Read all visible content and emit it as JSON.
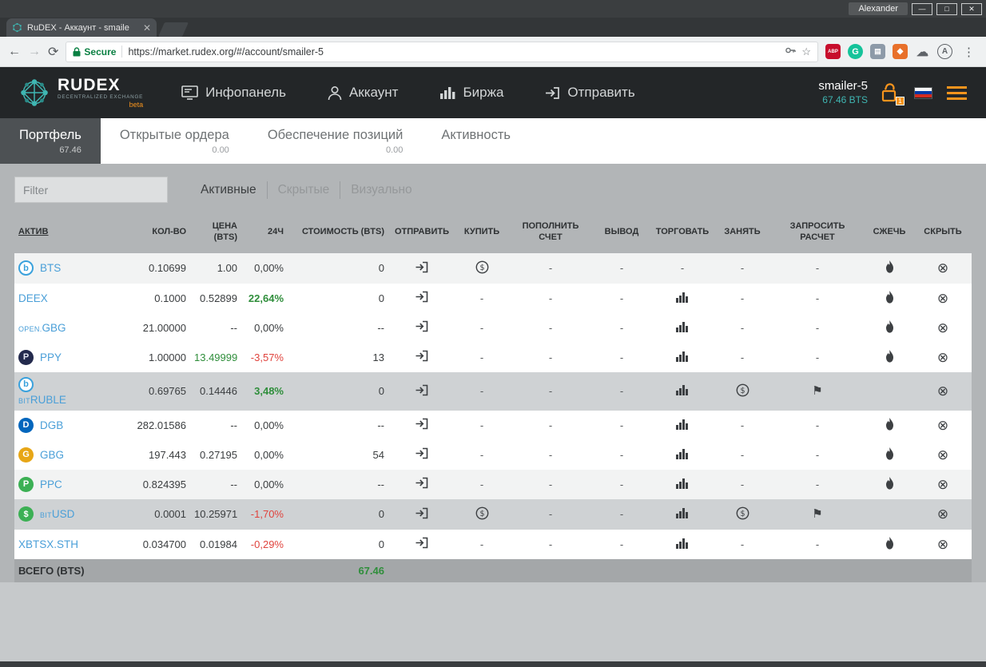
{
  "browser": {
    "user_button": "Alexander",
    "minimize": "—",
    "maximize": "□",
    "close": "✕",
    "tab_title": "RuDEX - Аккаунт - smaile",
    "secure_label": "Secure",
    "url": "https://market.rudex.org/#/account/smailer-5"
  },
  "header": {
    "logo_title": "RUDEX",
    "logo_subtitle": "DECENTRALIZED EXCHANGE",
    "logo_beta": "beta",
    "nav": [
      {
        "label": "Инфопанель"
      },
      {
        "label": "Аккаунт"
      },
      {
        "label": "Биржа"
      },
      {
        "label": "Отправить"
      }
    ],
    "account_name": "smailer-5",
    "account_balance": "67.46 BTS",
    "unlock_badge": "1"
  },
  "page_tabs": [
    {
      "label": "Портфель",
      "value": "67.46"
    },
    {
      "label": "Открытые ордера",
      "value": "0.00"
    },
    {
      "label": "Обеспечение позиций",
      "value": "0.00"
    },
    {
      "label": "Активность",
      "value": ""
    }
  ],
  "filter_placeholder": "Filter",
  "view_modes": [
    "Активные",
    "Скрытые",
    "Визуально"
  ],
  "table": {
    "columns": [
      "АКТИВ",
      "КОЛ-ВО",
      "ЦЕНА (BTS)",
      "24Ч",
      "СТОИМОСТЬ (BTS)",
      "ОТПРАВИТЬ",
      "КУПИТЬ",
      "ПОПОЛНИТЬ СЧЕТ",
      "ВЫВОД",
      "ТОРГОВАТЬ",
      "ЗАНЯТЬ",
      "ЗАПРОСИТЬ РАСЧЕТ",
      "СЖЕЧЬ",
      "СКРЫТЬ"
    ],
    "rows": [
      {
        "asset": "BTS",
        "prefix": "",
        "icon": "bts",
        "qty": "0.10699",
        "price": "1.00",
        "price_green": false,
        "change": "0,00%",
        "change_dir": "flat",
        "value": "0",
        "buy": true,
        "trade": false,
        "borrow": false,
        "settle": false,
        "burn": true,
        "tone": "light",
        "stacked": false
      },
      {
        "asset": "DEEX",
        "prefix": "",
        "icon": "none",
        "qty": "0.1000",
        "price": "0.52899",
        "price_green": false,
        "change": "22,64%",
        "change_dir": "up",
        "value": "0",
        "buy": false,
        "trade": true,
        "borrow": false,
        "settle": false,
        "burn": true,
        "tone": "white",
        "stacked": false
      },
      {
        "asset": "GBG",
        "prefix": "OPEN.",
        "icon": "none",
        "qty": "21.00000",
        "price": "--",
        "price_green": false,
        "change": "0,00%",
        "change_dir": "flat",
        "value": "--",
        "buy": false,
        "trade": true,
        "borrow": false,
        "settle": false,
        "burn": true,
        "tone": "white",
        "stacked": false
      },
      {
        "asset": "PPY",
        "prefix": "",
        "icon": "ppy",
        "qty": "1.00000",
        "price": "13.49999",
        "price_green": true,
        "change": "-3,57%",
        "change_dir": "down",
        "value": "13",
        "buy": false,
        "trade": true,
        "borrow": false,
        "settle": false,
        "burn": true,
        "tone": "white",
        "stacked": false
      },
      {
        "asset": "RUBLE",
        "prefix": "BIT",
        "icon": "bts",
        "qty": "0.69765",
        "price": "0.14446",
        "price_green": false,
        "change": "3,48%",
        "change_dir": "up",
        "value": "0",
        "buy": false,
        "trade": true,
        "borrow": true,
        "settle": true,
        "burn": false,
        "tone": "gray",
        "stacked": true
      },
      {
        "asset": "DGB",
        "prefix": "",
        "icon": "dgb",
        "qty": "282.01586",
        "price": "--",
        "price_green": false,
        "change": "0,00%",
        "change_dir": "flat",
        "value": "--",
        "buy": false,
        "trade": true,
        "borrow": false,
        "settle": false,
        "burn": true,
        "tone": "white",
        "stacked": false
      },
      {
        "asset": "GBG",
        "prefix": "",
        "icon": "gbg",
        "qty": "197.443",
        "price": "0.27195",
        "price_green": false,
        "change": "0,00%",
        "change_dir": "flat",
        "value": "54",
        "buy": false,
        "trade": true,
        "borrow": false,
        "settle": false,
        "burn": true,
        "tone": "white",
        "stacked": false
      },
      {
        "asset": "PPC",
        "prefix": "",
        "icon": "ppc",
        "qty": "0.824395",
        "price": "--",
        "price_green": false,
        "change": "0,00%",
        "change_dir": "flat",
        "value": "--",
        "buy": false,
        "trade": true,
        "borrow": false,
        "settle": false,
        "burn": true,
        "tone": "light",
        "stacked": false
      },
      {
        "asset": "USD",
        "prefix": "BIT",
        "icon": "usd",
        "qty": "0.0001",
        "price": "10.25971",
        "price_green": false,
        "change": "-1,70%",
        "change_dir": "down",
        "value": "0",
        "buy": true,
        "trade": true,
        "borrow": true,
        "settle": true,
        "burn": false,
        "tone": "gray",
        "stacked": false
      },
      {
        "asset": "XBTSX.STH",
        "prefix": "",
        "icon": "none",
        "qty": "0.034700",
        "price": "0.01984",
        "price_green": false,
        "change": "-0,29%",
        "change_dir": "down",
        "value": "0",
        "buy": false,
        "trade": true,
        "borrow": false,
        "settle": false,
        "burn": true,
        "tone": "white",
        "stacked": false
      }
    ],
    "footer_label": "ВСЕГО (BTS)",
    "footer_total": "67.46"
  }
}
